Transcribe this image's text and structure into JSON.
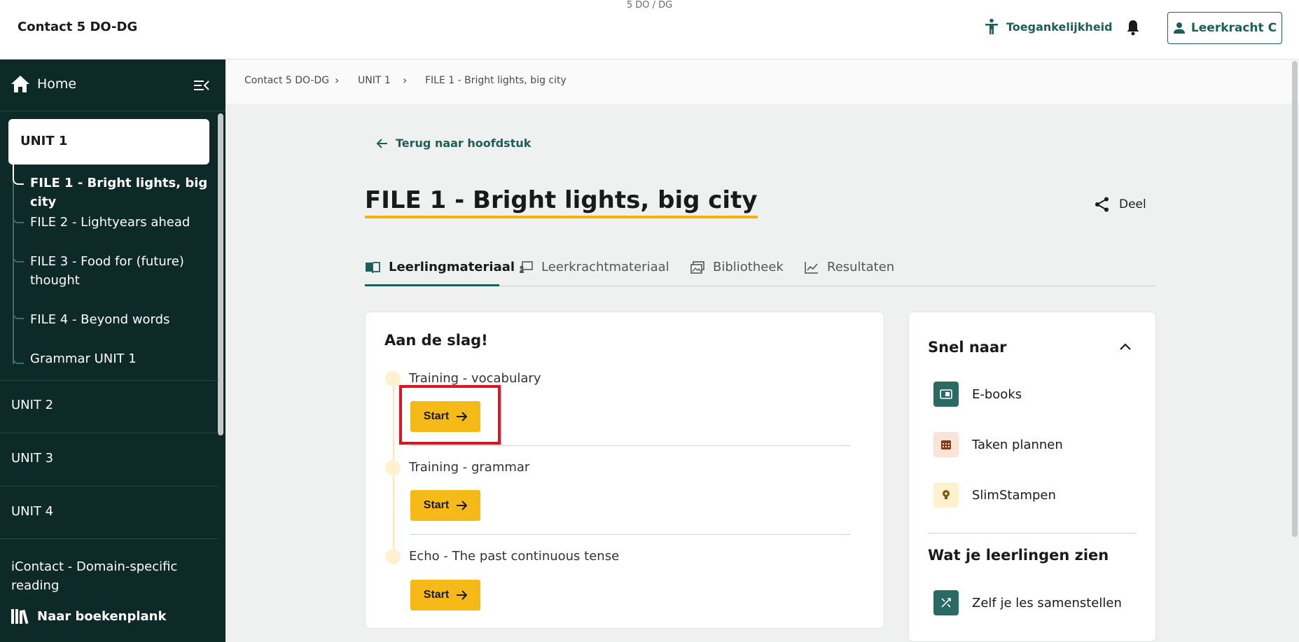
{
  "header": {
    "app_title": "Contact 5 DO-DG",
    "sub_title": "5 DO / DG",
    "accessibility_label": "Toegankelijkheid",
    "user_label": "Leerkracht C"
  },
  "sidebar": {
    "home_label": "Home",
    "active_unit": "UNIT 1",
    "files": [
      {
        "label": "FILE 1 - Bright lights, big city"
      },
      {
        "label": "FILE 2 - Lightyears ahead"
      },
      {
        "label": "FILE 3 - Food for (future) thought"
      },
      {
        "label": "FILE 4 - Beyond words"
      },
      {
        "label": "Grammar UNIT 1"
      }
    ],
    "units": [
      {
        "label": "UNIT 2"
      },
      {
        "label": "UNIT 3"
      },
      {
        "label": "UNIT 4"
      },
      {
        "label": "iContact - Domain-specific reading"
      }
    ],
    "bookshelf_label": "Naar boekenplank"
  },
  "breadcrumb": [
    "Contact 5 DO-DG",
    "UNIT 1",
    "FILE 1 - Bright lights, big city"
  ],
  "main": {
    "back_label": "Terug naar hoofdstuk",
    "title": "FILE 1 - Bright lights, big city",
    "share_label": "Deel",
    "tabs": [
      {
        "label": "Leerlingmateriaal"
      },
      {
        "label": "Leerkrachtmateriaal"
      },
      {
        "label": "Bibliotheek"
      },
      {
        "label": "Resultaten"
      }
    ],
    "card_title": "Aan de slag!",
    "lessons": [
      {
        "label": "Training - vocabulary",
        "button": "Start"
      },
      {
        "label": "Training - grammar",
        "button": "Start"
      },
      {
        "label": "Echo - The past continuous tense",
        "button": "Start"
      }
    ]
  },
  "side_panel": {
    "title": "Snel naar",
    "items": [
      {
        "label": "E-books"
      },
      {
        "label": "Taken plannen"
      },
      {
        "label": "SlimStampen"
      }
    ],
    "title2": "Wat je leerlingen zien",
    "items2": [
      {
        "label": "Zelf je les samenstellen"
      }
    ]
  },
  "colors": {
    "brand_dark": "#0e2a28",
    "accent_teal": "#1d5e57",
    "accent_yellow": "#f5b918",
    "highlight_red": "#e0141e"
  }
}
